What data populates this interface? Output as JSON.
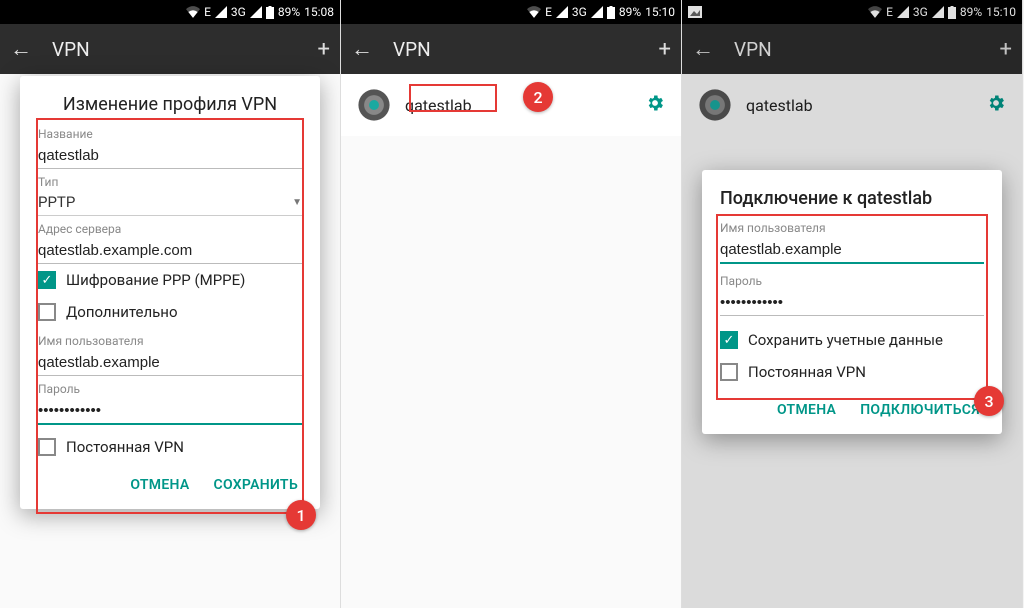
{
  "statusbar": {
    "network_e": "E",
    "network_3g": "3G",
    "battery": "89%",
    "time1": "15:08",
    "time2": "15:10",
    "time3": "15:10"
  },
  "header": {
    "title": "VPN"
  },
  "vpn_entry": {
    "name": "qatestlab"
  },
  "dlg_edit": {
    "title": "Изменение профиля VPN",
    "name_label": "Название",
    "name_value": "qatestlab",
    "type_label": "Тип",
    "type_value": "PPTP",
    "server_label": "Адрес сервера",
    "server_value": "qatestlab.example.com",
    "ppp_label": "Шифрование PPP (MPPE)",
    "advanced_label": "Дополнительно",
    "user_label": "Имя пользователя",
    "user_value": "qatestlab.example",
    "pass_label": "Пароль",
    "pass_value": "••••••••••••",
    "perm_label": "Постоянная VPN",
    "cancel": "ОТМЕНА",
    "save": "СОХРАНИТЬ"
  },
  "dlg_conn": {
    "title": "Подключение к qatestlab",
    "user_label": "Имя пользователя",
    "user_value": "qatestlab.example",
    "pass_label": "Пароль",
    "pass_value": "••••••••••••",
    "save_cred_label": "Сохранить учетные данные",
    "perm_label": "Постоянная VPN",
    "cancel": "ОТМЕНА",
    "connect": "ПОДКЛЮЧИТЬСЯ"
  },
  "badges": {
    "b1": "1",
    "b2": "2",
    "b3": "3"
  }
}
